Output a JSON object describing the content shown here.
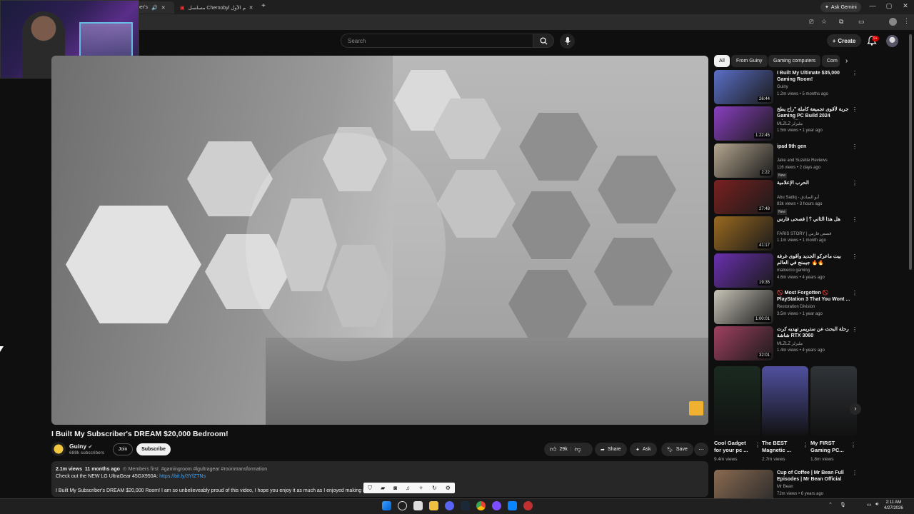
{
  "browser": {
    "tabs": [
      {
        "label": "ber's",
        "active": true
      },
      {
        "label": "مسلسل Chernobyl الموسم الأول",
        "active": false
      }
    ],
    "ask_gemini": "Ask Gemini",
    "window_controls": [
      "—",
      "▢",
      "✕"
    ]
  },
  "header": {
    "search_placeholder": "Search",
    "create_label": "Create",
    "notification_count": "9+"
  },
  "video": {
    "title": "I Built My Subscriber's DREAM $20,000 Bedroom!",
    "channel": {
      "name": "Guiny",
      "subscribers": "688k subscribers"
    },
    "join_label": "Join",
    "subscribe_label": "Subscribe",
    "likes": "29k",
    "share_label": "Share",
    "ask_label": "Ask",
    "save_label": "Save"
  },
  "description": {
    "views": "2.1m views",
    "age": "11 months ago",
    "members": "Members first",
    "hashtags": "#gamingroom #lgultragear #roomtransformation",
    "line1": "Check out the NEW LG UltraGear 45GX950A:",
    "link": "https://bit.ly/3YfZTNs",
    "line2": "I Built My Subscriber's DREAM $20,000 Room! I am so unbelieveably proud of this video, I hope you enjoy it as much as I enjoyed making it!"
  },
  "chips": [
    "All",
    "From Guiny",
    "Gaming computers",
    "Com"
  ],
  "recommendations": [
    {
      "title": "I Built My Ultimate $35,000 Gaming Room!",
      "channel": "Guiny",
      "meta": "1.2m views • 5 months ago",
      "duration": "26:44",
      "new": false,
      "color": "#5b6fc7"
    },
    {
      "title": "جربة لأقوى تجميعة كاملة \"راح يطخ Gaming PC Build 2024 \"الكرتونيل",
      "channel": "MLZLZ مليزلز",
      "meta": "1.5m views • 1 year ago",
      "duration": "1:22:45",
      "new": false,
      "color": "#8a3fc0"
    },
    {
      "title": "ipad 9th gen",
      "channel": "Jake and Suzette Reviews",
      "meta": "116 views • 2 days ago",
      "duration": "2:22",
      "new": true,
      "color": "#b5a690"
    },
    {
      "title": "الحرب الإعلامية",
      "channel": "Abu Sadiq - أبو الصادق",
      "meta": "83k views • 3 hours ago",
      "duration": "27:48",
      "new": true,
      "color": "#7a2020"
    },
    {
      "title": "هل هذا الثاني ؟ | فصحى فارس",
      "channel": "FARIS STORY | قصص فارس",
      "meta": "1.1m views • 1 month ago",
      "duration": "41:17",
      "new": false,
      "color": "#9a6a20"
    },
    {
      "title": "بيت ماعركو الجديد وأقوى غرفة جيمنج في العالم 🔥🔥",
      "channel": "malnerco gaming",
      "meta": "4.6m views • 4 years ago",
      "duration": "19:35",
      "new": false,
      "color": "#6a30b0"
    },
    {
      "title": "🚫 Most Forgotten 🚫 PlayStation 3 That You Wont ...",
      "channel": "Restoration Division",
      "meta": "3.5m views • 1 year ago",
      "duration": "1:00:01",
      "new": false,
      "color": "#c8c4b8"
    },
    {
      "title": "رحلة البحث عن ستريمر تهديه كرت شاشة RTX 3060",
      "channel": "MLZLZ مليزلز",
      "meta": "1.4m views • 4 years ago",
      "duration": "32:01",
      "new": false,
      "color": "#a04060"
    }
  ],
  "shorts": [
    {
      "title": "Cool Gadget for your pc ...",
      "views": "9.4m views",
      "color": "#1a2a20"
    },
    {
      "title": "The BEST Magnetic ...",
      "views": "2.7m views",
      "color": "#5050a0"
    },
    {
      "title": "My FIRST Gaming PC...",
      "views": "1.8m views",
      "color": "#303438"
    }
  ],
  "last_rec": {
    "title": "Cup of Coffee | Mr Bean Full Episodes | Mr Bean Official",
    "channel": "Mr Bean",
    "meta": "72m views • 6 years ago",
    "color": "#8a6a50"
  },
  "taskbar": {
    "time": "2:11 AM",
    "date": "4/27/2026"
  }
}
